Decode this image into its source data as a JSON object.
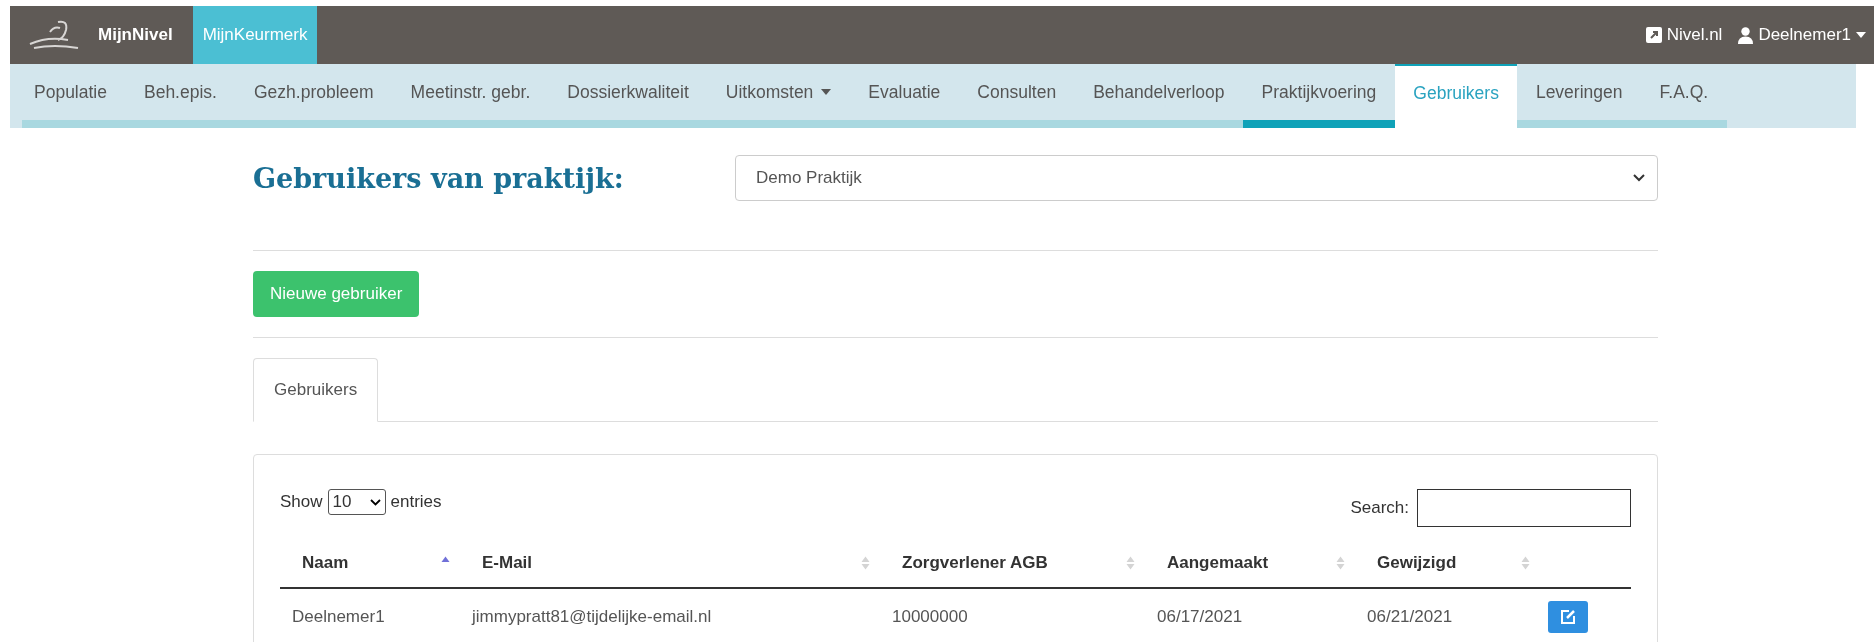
{
  "top_bar": {
    "brand": "MijnNivel",
    "apps": [
      {
        "label": "MijnKeurmerk",
        "selected": true
      }
    ],
    "links": [
      {
        "kind": "external",
        "label": "Nivel.nl"
      },
      {
        "kind": "user",
        "label": "Deelnemer1"
      }
    ]
  },
  "nav": [
    {
      "label": "Populatie",
      "selected": false,
      "underlined": false,
      "dropdown": false
    },
    {
      "label": "Beh.epis.",
      "selected": false,
      "underlined": false,
      "dropdown": false
    },
    {
      "label": "Gezh.probleem",
      "selected": false,
      "underlined": false,
      "dropdown": false
    },
    {
      "label": "Meetinstr. gebr.",
      "selected": false,
      "underlined": false,
      "dropdown": false
    },
    {
      "label": "Dossierkwaliteit",
      "selected": false,
      "underlined": false,
      "dropdown": false
    },
    {
      "label": "Uitkomsten",
      "selected": false,
      "underlined": false,
      "dropdown": true
    },
    {
      "label": "Evaluatie",
      "selected": false,
      "underlined": false,
      "dropdown": false
    },
    {
      "label": "Consulten",
      "selected": false,
      "underlined": false,
      "dropdown": false
    },
    {
      "label": "Behandelverloop",
      "selected": false,
      "underlined": false,
      "dropdown": false
    },
    {
      "label": "Praktijkvoering",
      "selected": false,
      "underlined": true,
      "dropdown": false
    },
    {
      "label": "Gebruikers",
      "selected": true,
      "underlined": false,
      "dropdown": false
    },
    {
      "label": "Leveringen",
      "selected": false,
      "underlined": false,
      "dropdown": false
    },
    {
      "label": "F.A.Q.",
      "selected": false,
      "underlined": false,
      "dropdown": false
    }
  ],
  "heading": "Gebruikers van praktijk:",
  "practice_select": {
    "value": "Demo Praktijk"
  },
  "new_user_button": "Nieuwe gebruiker",
  "tabs": [
    {
      "label": "Gebruikers",
      "selected": true
    }
  ],
  "table_controls": {
    "show_label": "Show",
    "page_size": "10",
    "entries_label": "entries",
    "search_label": "Search:"
  },
  "table": {
    "columns": [
      {
        "label": "Naam",
        "sorted": true
      },
      {
        "label": "E-Mail",
        "sorted": false
      },
      {
        "label": "Zorgverlener AGB",
        "sorted": false
      },
      {
        "label": "Aangemaakt",
        "sorted": false
      },
      {
        "label": "Gewijzigd",
        "sorted": false
      }
    ],
    "rows": [
      {
        "cells": [
          "Deelnemer1",
          "jimmypratt81@tijdelijke-email.nl",
          "10000000",
          "06/17/2021",
          "06/21/2021"
        ]
      }
    ]
  }
}
